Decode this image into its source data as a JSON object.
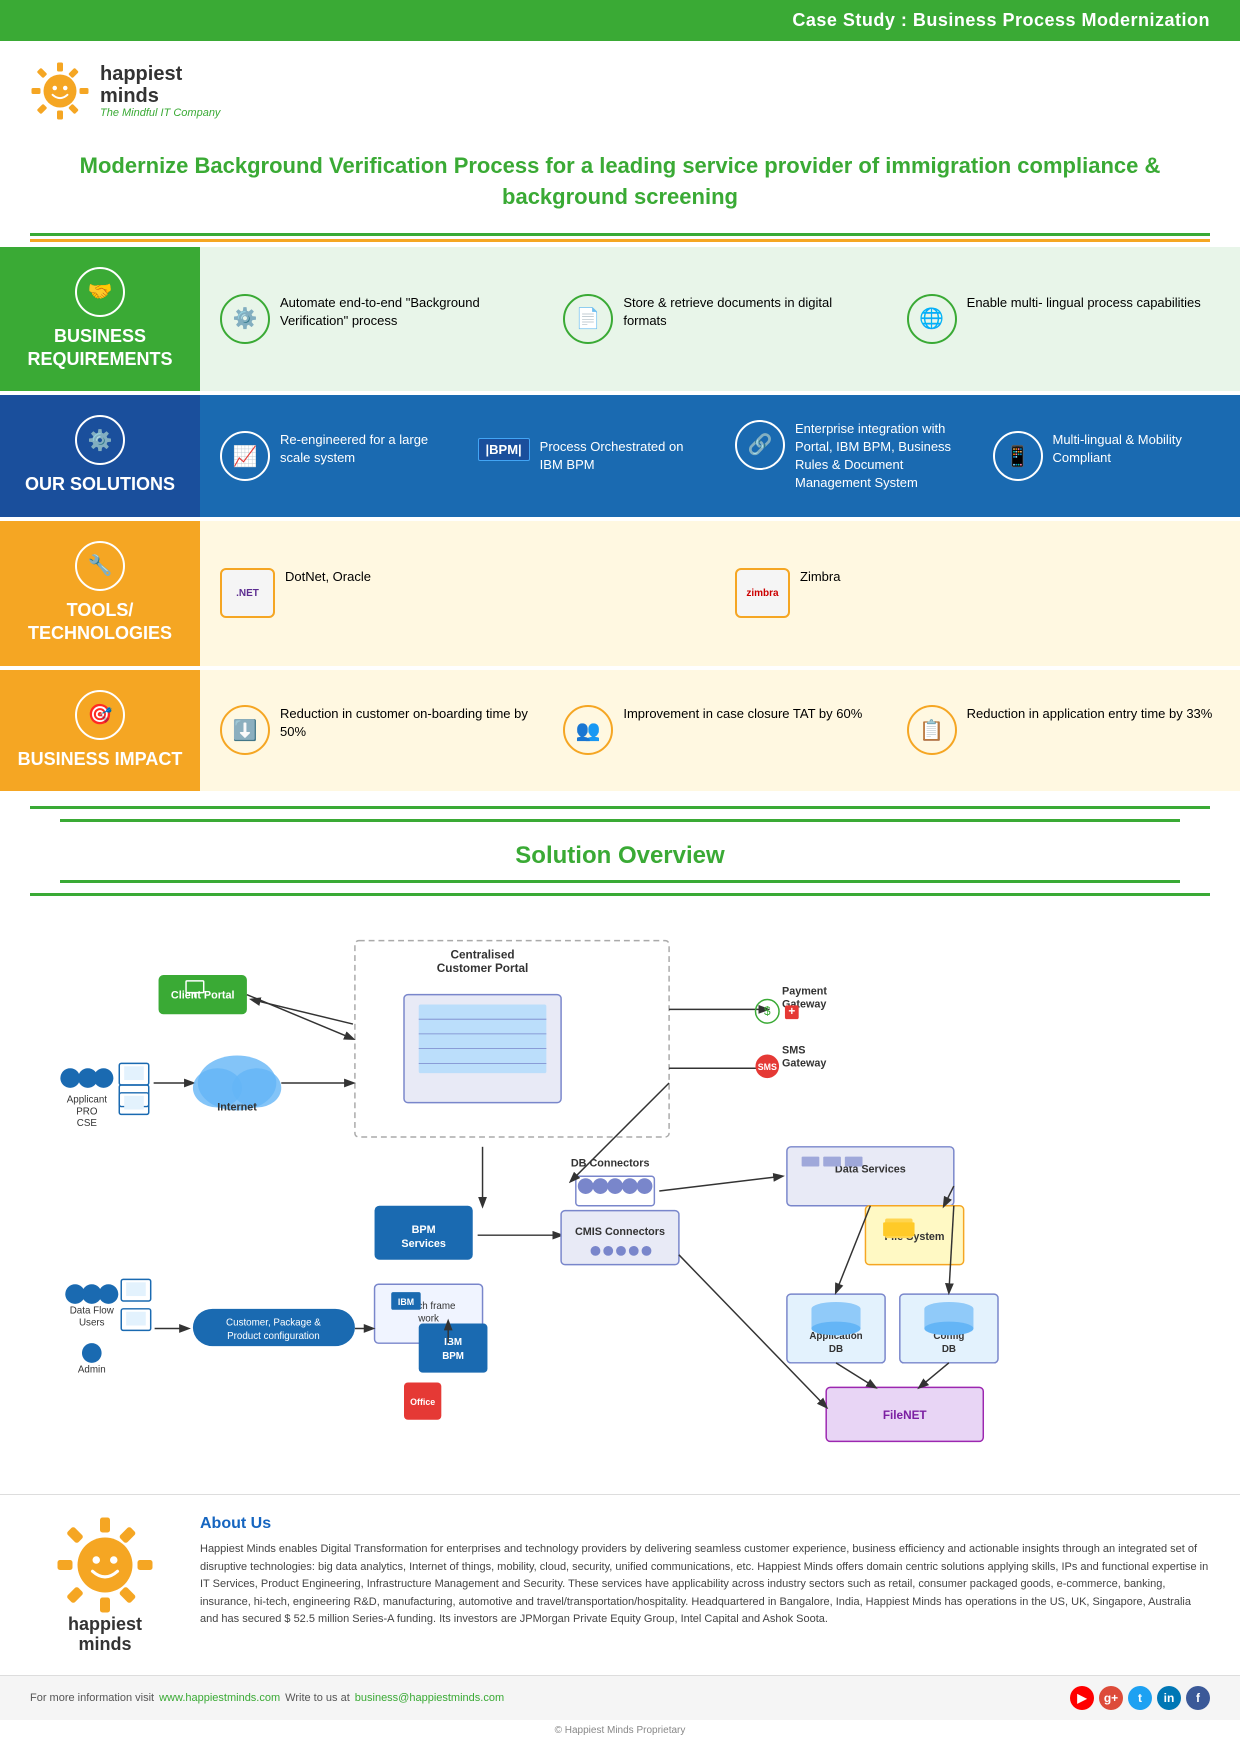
{
  "header": {
    "banner": "Case Study : Business Process Modernization"
  },
  "logo": {
    "name1": "happiest",
    "name2": "minds",
    "tagline": "The Mindful IT Company"
  },
  "title": "Modernize Background Verification Process for a leading service provider of immigration compliance & background screening",
  "sections": {
    "business_requirements": {
      "label": "BUSINESS REQUIREMENTS",
      "items": [
        {
          "text": "Automate end-to-end \"Background Verification\" process"
        },
        {
          "text": "Store & retrieve documents in digital formats"
        },
        {
          "text": "Enable multi- lingual process capabilities"
        }
      ]
    },
    "our_solutions": {
      "label": "OUR SOLUTIONS",
      "items": [
        {
          "text": "Re-engineered for a large scale system"
        },
        {
          "badge": "IBM BPM",
          "text": "Process Orchestrated on IBM BPM"
        },
        {
          "text": "Enterprise integration with Portal, IBM BPM, Business Rules & Document Management System"
        },
        {
          "text": "Multi-lingual & Mobility Compliant"
        }
      ]
    },
    "tools": {
      "label": "TOOLS/ TECHNOLOGIES",
      "items": [
        {
          "text": "DotNet, Oracle"
        },
        {
          "text": "Zimbra"
        }
      ]
    },
    "business_impact": {
      "label": "BUSINESS IMPACT",
      "items": [
        {
          "text": "Reduction in customer on-boarding time by 50%"
        },
        {
          "text": "Improvement in case closure TAT by 60%"
        },
        {
          "text": "Reduction in application entry time by 33%"
        }
      ]
    }
  },
  "solution_overview": {
    "title": "Solution Overview",
    "nodes": {
      "client_portal": "Client Portal",
      "centralised_portal": "Centralised Customer Portal",
      "payment_gateway": "Payment Gateway",
      "sms_gateway": "SMS Gateway",
      "db_connectors": "DB Connectors",
      "data_services": "Data Services",
      "bpm_services": "BPM Services",
      "cmis_connectors": "CMIS  Connectors",
      "coach_framework": "coach frame work",
      "ibm_bpm": "IBM BPM",
      "file_system": "File System",
      "application_db": "Application DB",
      "config_db": "Config DB",
      "filenet": "FileNet",
      "internet": "Internet",
      "applicant": "Applicant PRO CSE",
      "data_flow_users": "Data Flow Users",
      "admin": "Admin",
      "customer_config": "Customer, Package & Product configuration",
      "ms_office": "MS Office"
    }
  },
  "about": {
    "title": "About Us",
    "text": "Happiest Minds enables Digital Transformation for enterprises and technology providers by delivering seamless customer experience, business efficiency and actionable insights through an integrated set of disruptive technologies: big data analytics, Internet of things, mobility, cloud, security, unified communications, etc. Happiest Minds offers domain centric solutions applying skills, IPs and functional expertise in IT Services, Product Engineering, Infrastructure Management and Security. These services have applicability across industry sectors such as retail, consumer packaged goods, e-commerce, banking, insurance, hi-tech, engineering R&D, manufacturing, automotive and travel/transportation/hospitality. Headquartered in Bangalore, India, Happiest Minds has operations in the US, UK, Singapore, Australia and has secured $ 52.5 million Series-A funding. Its investors are JPMorgan Private Equity Group, Intel Capital and Ashok Soota."
  },
  "footer": {
    "visit_text": "For more information visit",
    "website": "www.happiestminds.com",
    "write_text": "Write to us at",
    "email": "business@happiestminds.com",
    "copyright": "© Happiest Minds Proprietary"
  }
}
